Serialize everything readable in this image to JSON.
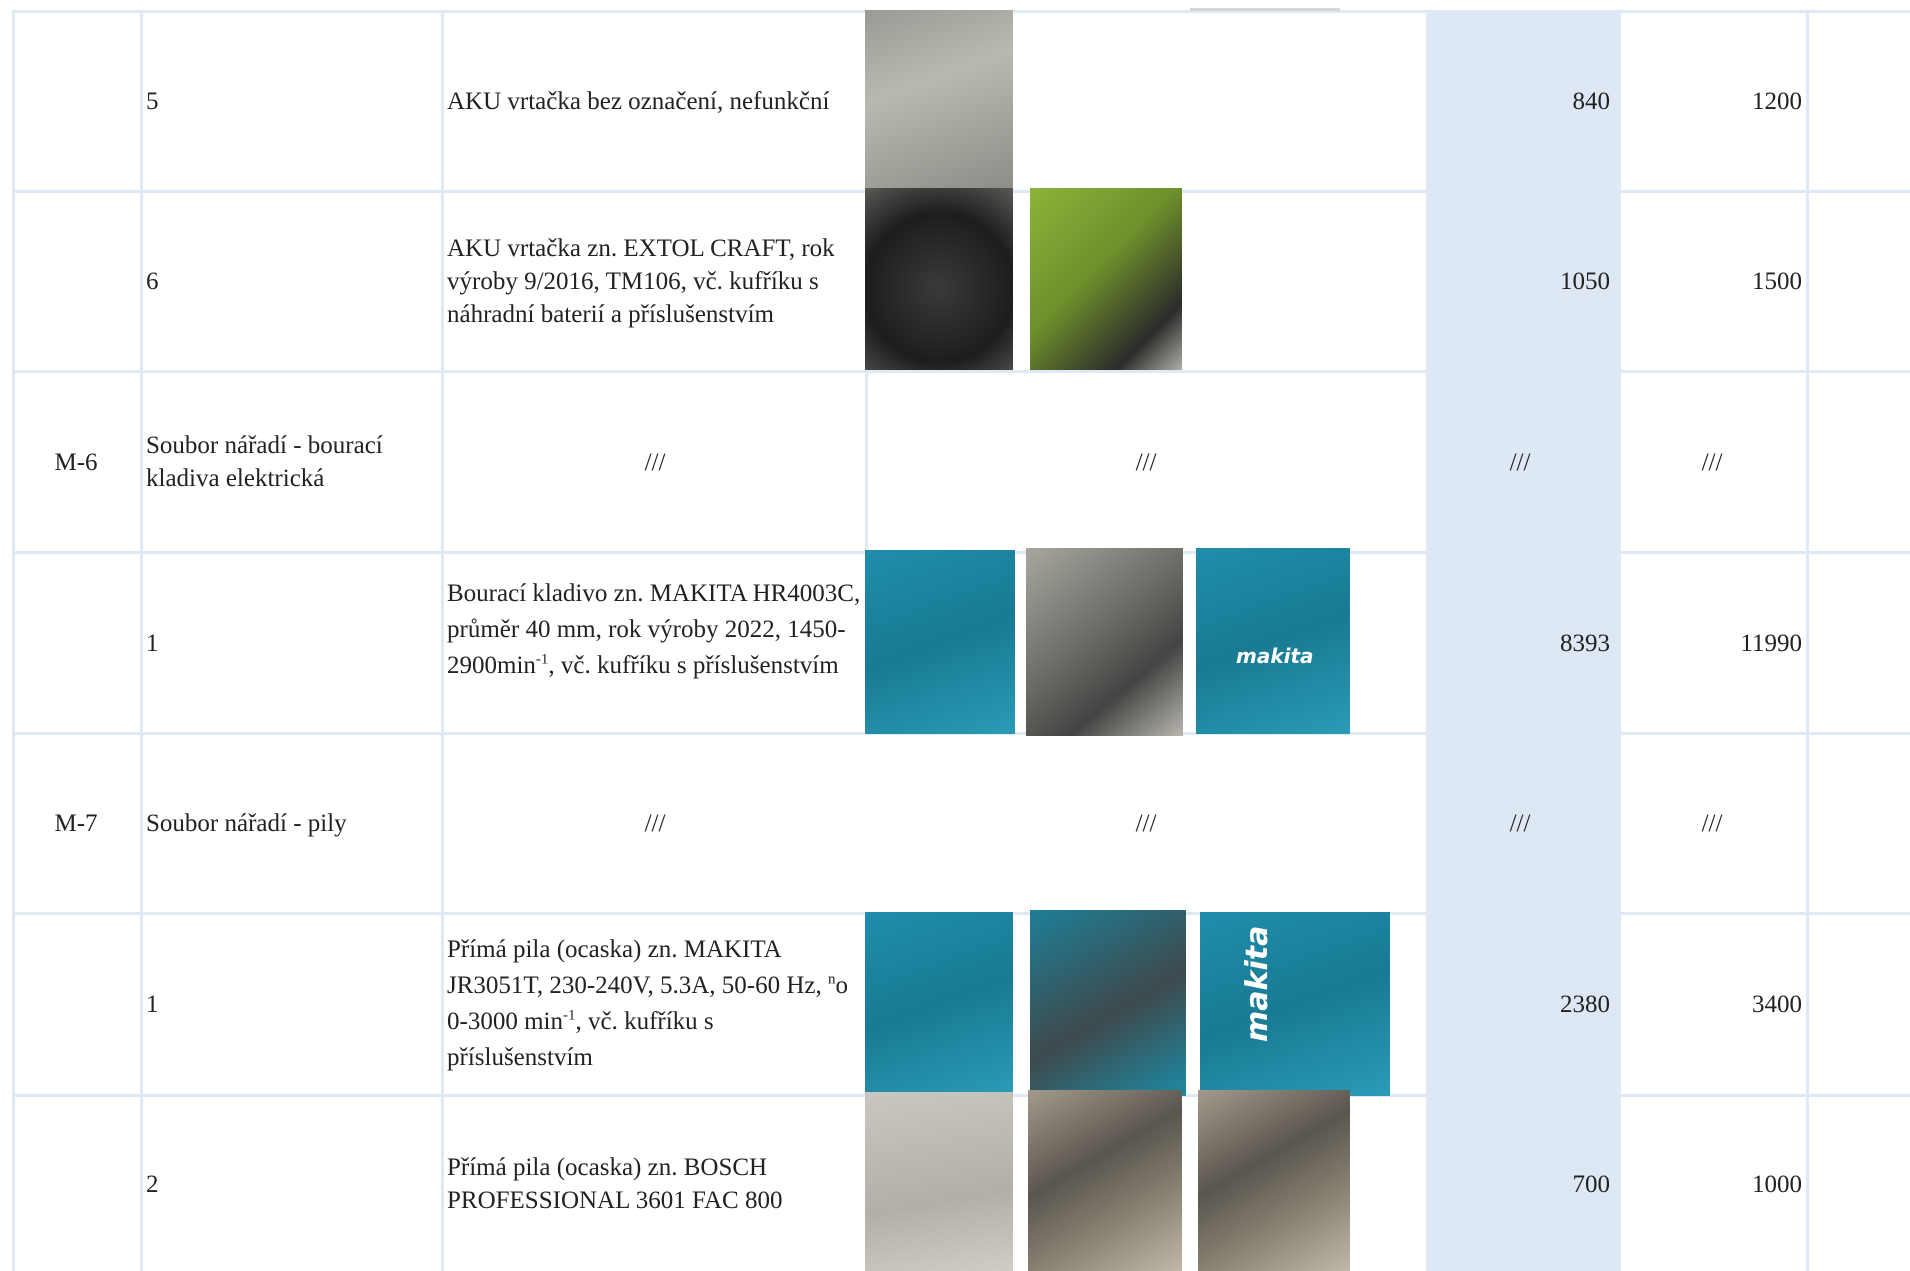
{
  "rows": [
    {
      "code": "",
      "name": "",
      "item": "5",
      "desc": "AKU vrtačka bez označení, nefunkční",
      "price_a": "840",
      "price_b": "1200"
    },
    {
      "code": "",
      "name": "",
      "item": "6",
      "desc": "AKU vrtačka zn. EXTOL CRAFT, rok výroby 9/2016, TM106, vč. kufříku s náhradní baterií a příslušenstvím",
      "price_a": "1050",
      "price_b": "1500"
    },
    {
      "code": "M-6",
      "name": "Soubor nářadí - bourací kladiva elektrická",
      "item": "",
      "desc": "///",
      "photos": "///",
      "price_a": "///",
      "price_b": "///"
    },
    {
      "code": "",
      "name": "",
      "item": "1",
      "desc_pre": "Bourací kladivo zn. MAKITA HR4003C, průměr 40 mm, rok výroby 2022, 1450-2900min",
      "desc_sup": "-1",
      "desc_post": ", vč. kufříku s příslušenstvím",
      "price_a": "8393",
      "price_b": "11990"
    },
    {
      "code": "M-7",
      "name": "Soubor nářadí - pily",
      "item": "",
      "desc": "///",
      "photos": "///",
      "price_a": "///",
      "price_b": "///"
    },
    {
      "code": "",
      "name": "",
      "item": "1",
      "desc_pre": "Přímá pila (ocaska) zn. MAKITA JR3051T, 230-240V, 5.3A, 50-60 Hz, ",
      "desc_sup1": "n",
      "desc_mid": "o 0-3000 min",
      "desc_sup2": "-1",
      "desc_post": ", vč. kufříku s příslušenstvím",
      "price_a": "2380",
      "price_b": "3400"
    },
    {
      "code": "",
      "name": "",
      "item": "2",
      "desc": "Přímá pila (ocaska) zn. BOSCH PROFESSIONAL 3601 FAC 800",
      "price_a": "700",
      "price_b": "1000"
    }
  ],
  "brand": {
    "makita": "makita"
  },
  "colors": {
    "highlight_column": "#dde8f4",
    "grid": "#dfe9f5"
  }
}
